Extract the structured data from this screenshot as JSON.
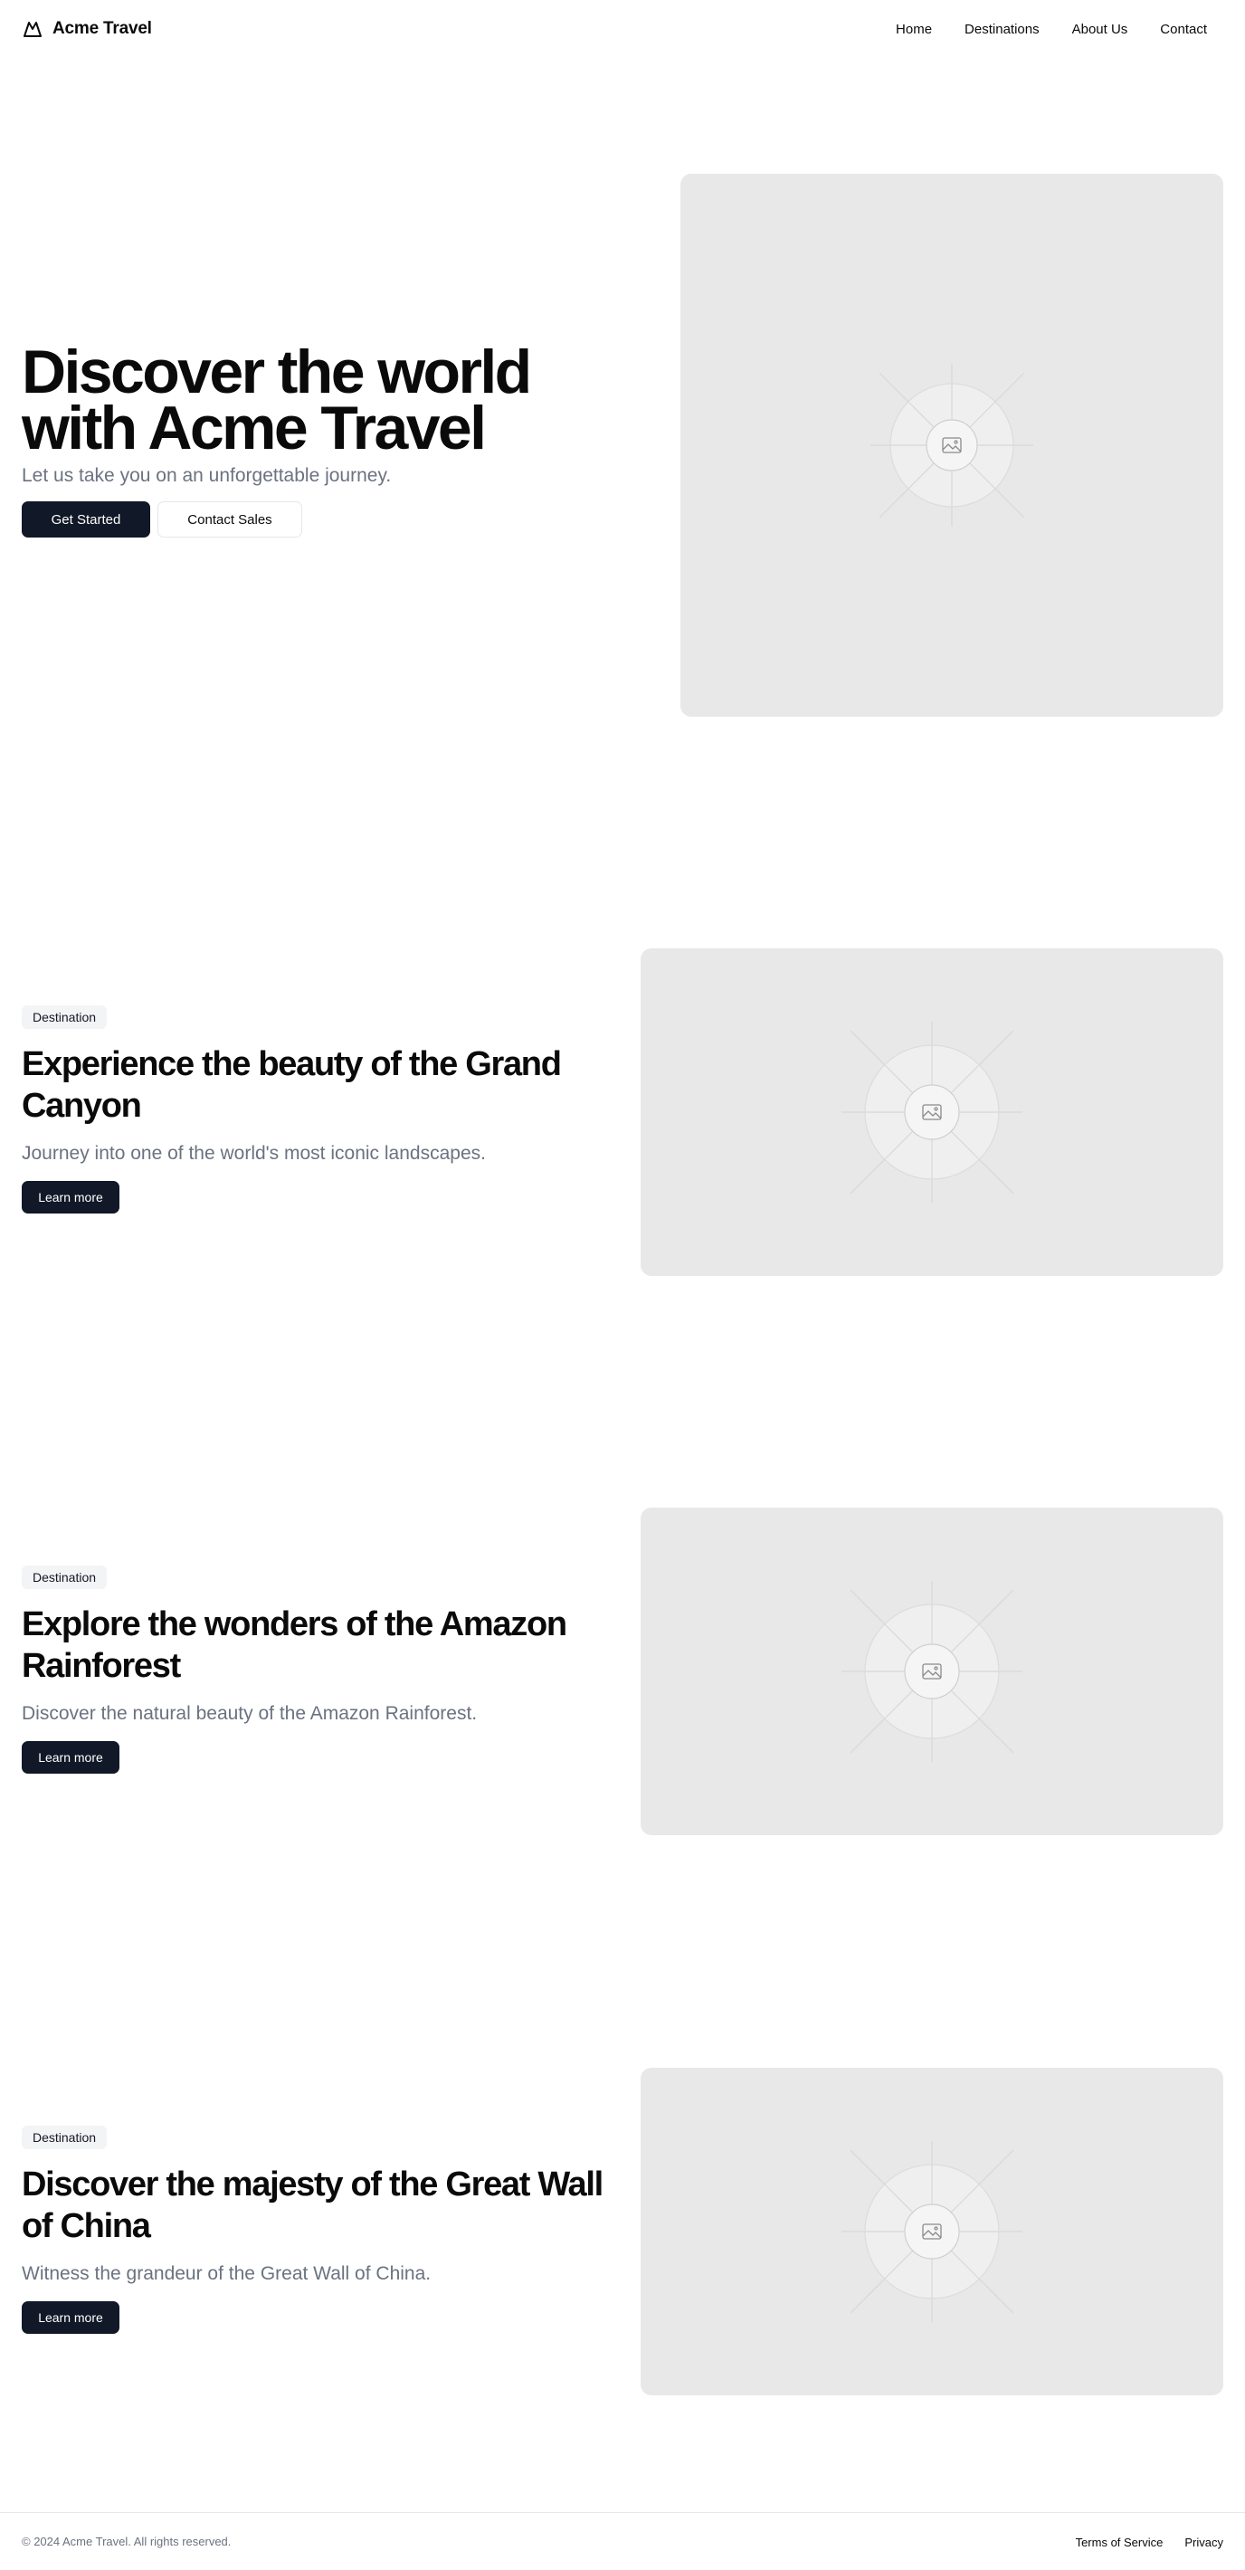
{
  "header": {
    "brand": {
      "name": "Acme Travel",
      "icon": "mountain-icon"
    },
    "nav": [
      {
        "label": "Home"
      },
      {
        "label": "Destinations"
      },
      {
        "label": "About Us"
      },
      {
        "label": "Contact"
      }
    ]
  },
  "hero": {
    "title": "Discover the world with Acme Travel",
    "subtitle": "Let us take you on an unforgettable journey.",
    "primary_button": "Get Started",
    "secondary_button": "Contact Sales",
    "image_icon": "image-placeholder-icon"
  },
  "destinations": [
    {
      "badge": "Destination",
      "title": "Experience the beauty of the Grand Canyon",
      "subtitle": "Journey into one of the world's most iconic landscapes.",
      "button": "Learn more"
    },
    {
      "badge": "Destination",
      "title": "Explore the wonders of the Amazon Rainforest",
      "subtitle": "Discover the natural beauty of the Amazon Rainforest.",
      "button": "Learn more"
    },
    {
      "badge": "Destination",
      "title": "Discover the majesty of the Great Wall of China",
      "subtitle": "Witness the grandeur of the Great Wall of China.",
      "button": "Learn more"
    }
  ],
  "footer": {
    "copyright": "© 2024 Acme Travel. All rights reserved.",
    "links": [
      {
        "label": "Terms of Service"
      },
      {
        "label": "Privacy"
      }
    ]
  },
  "colors": {
    "primary": "#111827",
    "muted_text": "#6b7280",
    "placeholder_bg": "#e8e8e8"
  }
}
